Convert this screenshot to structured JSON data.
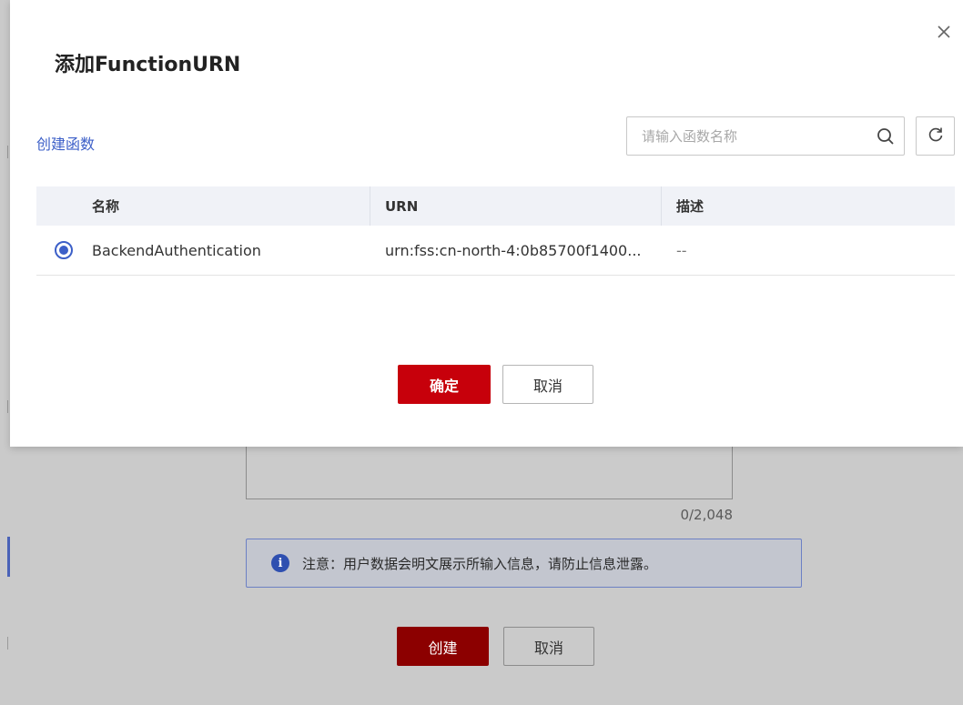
{
  "background": {
    "counter": "0/2,048",
    "notice": "注意：用户数据会明文展示所输入信息，请防止信息泄露。",
    "create_button": "创建",
    "cancel_button": "取消"
  },
  "modal": {
    "title": "添加FunctionURN",
    "create_function_link": "创建函数",
    "search": {
      "placeholder": "请输入函数名称",
      "value": ""
    },
    "table": {
      "columns": [
        "名称",
        "URN",
        "描述"
      ],
      "rows": [
        {
          "selected": true,
          "name": "BackendAuthentication",
          "urn": "urn:fss:cn-north-4:0b85700f1400...",
          "description": "--"
        }
      ]
    },
    "confirm_button": "确定",
    "cancel_button": "取消"
  },
  "colors": {
    "primary_red": "#c7000b",
    "link_blue": "#3c5fc8",
    "info_blue": "#2e4fb0"
  },
  "icons": {
    "close": "close-icon",
    "search": "search-icon",
    "refresh": "refresh-icon",
    "info": "info-icon"
  }
}
